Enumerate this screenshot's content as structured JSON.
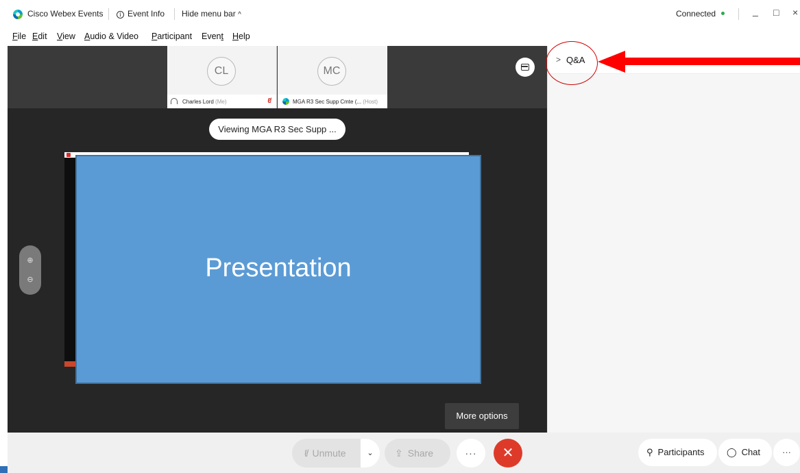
{
  "titlebar": {
    "app_name": "Cisco Webex Events",
    "event_info": "Event Info",
    "hide_menu_bar": "Hide menu bar",
    "hide_menu_chevron": "^",
    "status": "Connected",
    "minimize_glyph": "_",
    "maximize_glyph": "□",
    "close_glyph": "×"
  },
  "menu": {
    "items": [
      {
        "u": "F",
        "rest": "ile"
      },
      {
        "u": "E",
        "rest": "dit"
      },
      {
        "u": "V",
        "rest": "iew"
      },
      {
        "u": "A",
        "rest": "udio & Video"
      },
      {
        "u": "P",
        "rest": "articipant"
      },
      {
        "pre": "Even",
        "u": "t",
        "rest": ""
      },
      {
        "u": "H",
        "rest": "elp"
      }
    ]
  },
  "participants": [
    {
      "initials": "CL",
      "name": "Charles Lord",
      "note": "(Me)"
    },
    {
      "initials": "MC",
      "name": "MGA R3 Sec Supp Cmte (...",
      "note": "(Host)"
    }
  ],
  "stage": {
    "viewing": "Viewing MGA R3 Sec Supp ...",
    "presentation_text": "Presentation",
    "more_options_tooltip": "More options",
    "zoom_in_glyph": "⊕",
    "zoom_out_glyph": "⊖"
  },
  "side_panel": {
    "chevron": ">",
    "title": "Q&A"
  },
  "controls": {
    "unmute": "Unmute",
    "unmute_caret": "⌄",
    "share": "Share",
    "more": "···",
    "leave": "✕",
    "participants": "Participants",
    "chat": "Chat",
    "panel_more": "···"
  },
  "colors": {
    "presentation_fill": "#5b9bd5",
    "leave_red": "#de3a2a",
    "annotation_red": "#ff0000",
    "connected_green": "#2fa84f"
  },
  "icons": [
    "webex-logo-icon",
    "info-icon",
    "headset-icon",
    "muted-mic-icon",
    "layout-icon",
    "zoom-in-icon",
    "zoom-out-icon",
    "mic-icon",
    "share-icon",
    "participants-icon",
    "chat-icon"
  ]
}
